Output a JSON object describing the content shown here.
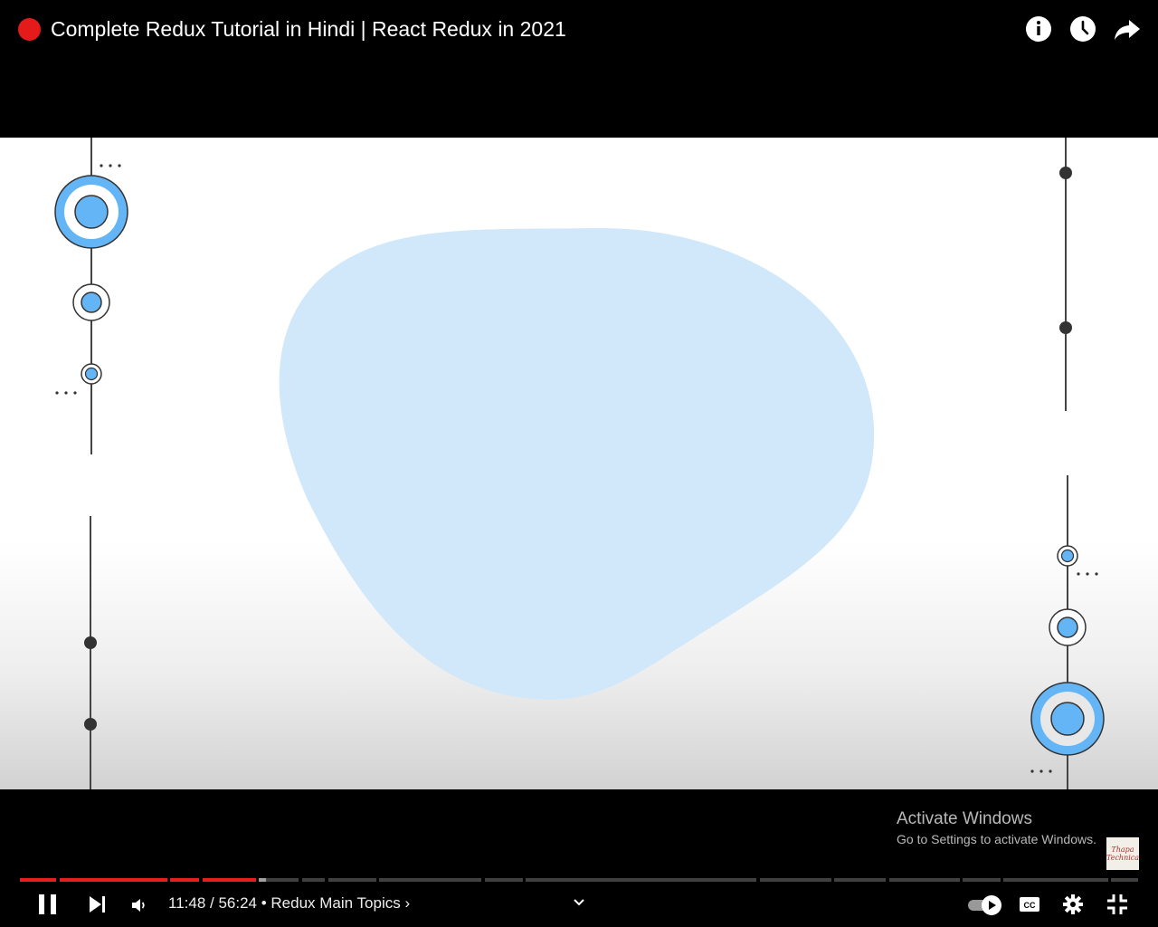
{
  "header": {
    "title": "Complete Redux Tutorial in Hindi | React Redux in 2021",
    "icons": [
      "info-icon",
      "watch-later-icon",
      "share-icon"
    ]
  },
  "overlay": {
    "activate_title": "Activate Windows",
    "activate_sub": "Go to Settings to activate Windows.",
    "watermark_text": "Thapa Technical"
  },
  "player": {
    "current_time": "11:48",
    "duration": "56:24",
    "separator": " / ",
    "chapter_bullet": " • ",
    "chapter": "Redux Main Topics",
    "chapter_arrow": "›",
    "progress_fraction": 0.209,
    "autoplay": true,
    "colors": {
      "played": "#e61e1e",
      "live_dot": "#e51a1a",
      "accent_blue": "#64b5f6"
    }
  }
}
